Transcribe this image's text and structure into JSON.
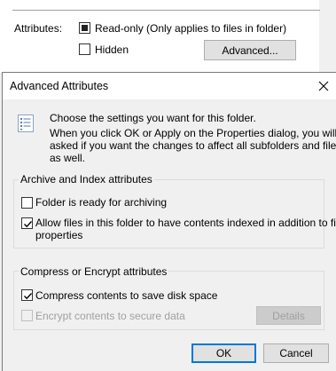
{
  "properties": {
    "attributes_label": "Attributes:",
    "readonly_label": "Read-only (Only applies to files in folder)",
    "readonly_state": "indeterminate",
    "hidden_label": "Hidden",
    "hidden_checked": false,
    "advanced_button": "Advanced..."
  },
  "dialog": {
    "title": "Advanced Attributes",
    "intro_line1": "Choose the settings you want for this folder.",
    "intro_line2": "When you click OK or Apply on the Properties dialog, you will be",
    "intro_line3": "asked if you want the changes to affect all subfolders and files",
    "intro_line4": "as well.",
    "archive_group": {
      "title": "Archive and Index attributes",
      "archiving_label": "Folder is ready for archiving",
      "archiving_checked": false,
      "index_label_line1": "Allow files in this folder to have contents indexed in addition to file",
      "index_label_line2": "properties",
      "index_checked": true
    },
    "compress_group": {
      "title": "Compress or Encrypt attributes",
      "compress_label": "Compress contents to save disk space",
      "compress_checked": true,
      "encrypt_label": "Encrypt contents to secure data",
      "encrypt_checked": false,
      "encrypt_enabled": false,
      "details_button": "Details",
      "details_enabled": false
    },
    "ok_button": "OK",
    "cancel_button": "Cancel"
  },
  "colors": {
    "accent": "#0078d7",
    "window_bg": "#f0f0f0",
    "disabled_text": "#a0a0a0"
  },
  "icons": {
    "dialog_icon": "settings-list-icon",
    "close": "close-icon"
  }
}
